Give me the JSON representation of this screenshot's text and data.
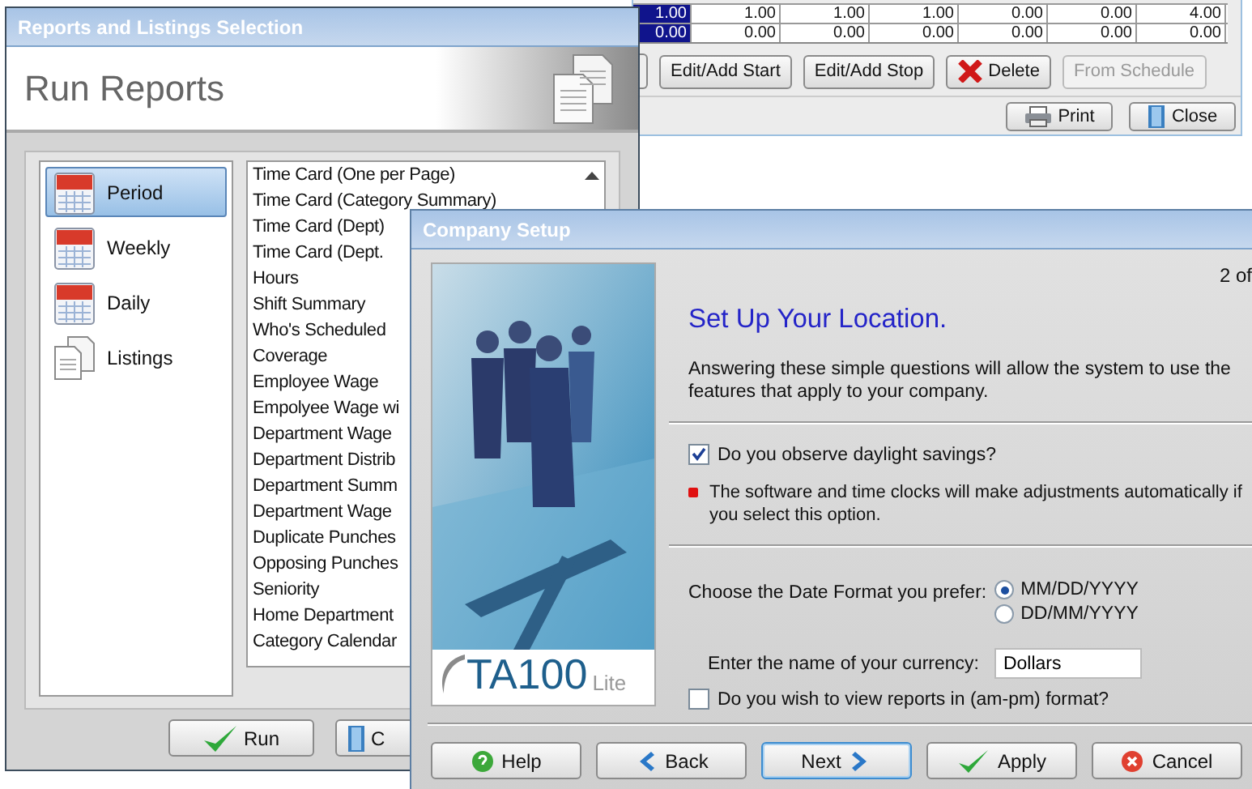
{
  "background_window": {
    "grid_rows": [
      {
        "cells": [
          {
            "text": "1.00",
            "selected": true
          },
          {
            "text": "1.00",
            "selected": false
          },
          {
            "text": "1.00",
            "selected": false
          },
          {
            "text": "1.00",
            "selected": false
          },
          {
            "text": "0.00",
            "selected": false
          },
          {
            "text": "0.00",
            "selected": false
          },
          {
            "text": "4.00",
            "selected": false
          }
        ]
      },
      {
        "cells": [
          {
            "text": "0.00",
            "selected": true
          },
          {
            "text": "0.00",
            "selected": false
          },
          {
            "text": "0.00",
            "selected": false
          },
          {
            "text": "0.00",
            "selected": false
          },
          {
            "text": "0.00",
            "selected": false
          },
          {
            "text": "0.00",
            "selected": false
          },
          {
            "text": "0.00",
            "selected": false
          }
        ]
      }
    ],
    "buttons": [
      {
        "label": "Edit/Add Start",
        "disabled": false
      },
      {
        "label": "Edit/Add Stop",
        "disabled": false
      },
      {
        "label": "Delete",
        "disabled": false
      },
      {
        "label": "From Schedule",
        "disabled": true
      }
    ],
    "footer_buttons": [
      {
        "label": "Print"
      },
      {
        "label": "Close"
      }
    ]
  },
  "reports_window": {
    "title": "Reports and Listings Selection",
    "header": "Run Reports",
    "categories": [
      {
        "label": "Period",
        "kind": "calendar",
        "selected": true
      },
      {
        "label": "Weekly",
        "kind": "calendar",
        "selected": false
      },
      {
        "label": "Daily",
        "kind": "calendar",
        "selected": false
      },
      {
        "label": "Listings",
        "kind": "documents",
        "selected": false
      }
    ],
    "reports": [
      "Time Card (One per Page)",
      "Time Card (Category Summary)",
      "Time Card (Dept)",
      "Time Card (Dept.",
      "Hours",
      "Shift Summary",
      "Who's Scheduled",
      "Coverage",
      "Employee Wage",
      "Empolyee Wage wi",
      "Department Wage",
      "Department Distrib",
      "Department Summ",
      "Department Wage",
      "Duplicate Punches",
      "Opposing Punches",
      "Seniority",
      "Home Department",
      "Category Calendar"
    ],
    "buttons": [
      {
        "label": "Run"
      },
      {
        "label": "C"
      }
    ]
  },
  "setup_window": {
    "title": "Company Setup",
    "logo": {
      "name": "TA100",
      "suffix": "Lite"
    },
    "step": "2 of",
    "heading": "Set Up Your Location.",
    "intro": "Answering these simple questions will allow the system to use the features that apply to your company.",
    "daylight": {
      "label": "Do you observe daylight savings?",
      "checked": true
    },
    "note": "The software and time clocks will make adjustments automatically if you select this option.",
    "date_format": {
      "label": "Choose the Date Format you prefer:",
      "options": [
        {
          "label": "MM/DD/YYYY",
          "selected": true
        },
        {
          "label": "DD/MM/YYYY",
          "selected": false
        }
      ]
    },
    "currency": {
      "label": "Enter the name of your currency:",
      "value": "Dollars"
    },
    "ampm": {
      "label": "Do you wish to view reports in (am-pm) format?",
      "checked": false
    },
    "buttons": [
      {
        "label": "Help",
        "focused": false
      },
      {
        "label": "Back",
        "focused": false
      },
      {
        "label": "Next",
        "focused": true
      },
      {
        "label": "Apply",
        "focused": false
      },
      {
        "label": "Cancel",
        "focused": false
      }
    ]
  }
}
